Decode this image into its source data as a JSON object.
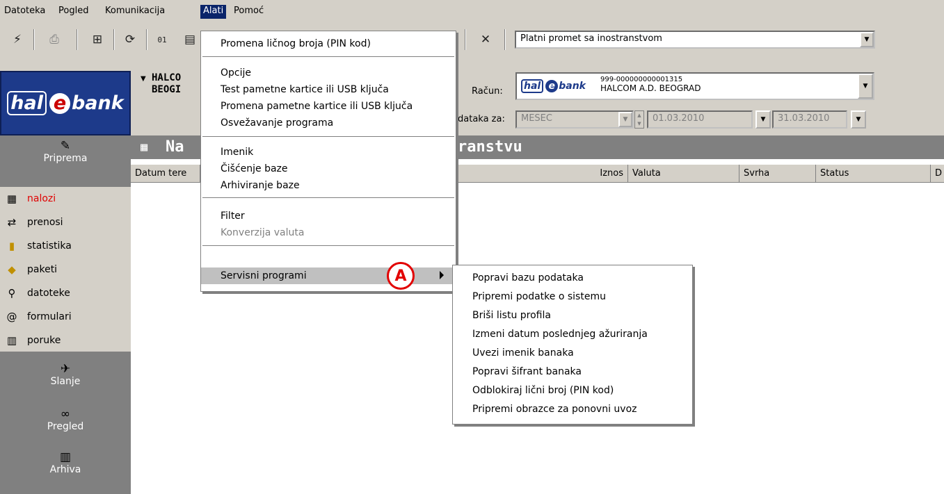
{
  "menubar": [
    "Datoteka",
    "Pogled",
    "Komunikacija",
    "Alati",
    "Pomoć"
  ],
  "toolbar": {
    "icons": [
      "signal-icon",
      "print-icon",
      "book-icon",
      "sync-icon",
      "binary-icon",
      "doc-icon",
      "tools-icon"
    ],
    "payment_type": "Platni promet sa inostranstvom"
  },
  "header": {
    "company_line1": "HALCO",
    "company_line2": "BEOGI",
    "account_label": "Račun:",
    "account_number": "999-000000000001315",
    "account_owner": "HALCOM A.D. BEOGRAD",
    "period_label": "dataka za:",
    "period_value": "MESEC",
    "date_from": "01.03.2010",
    "date_to": "31.03.2010"
  },
  "title": {
    "left": "Na",
    "right": "ranstvu"
  },
  "columns": [
    "Datum tere",
    "Iznos",
    "Valuta",
    "Svrha",
    "Status",
    "D"
  ],
  "sidebar": {
    "logo": "hal e bank",
    "logo_parts": [
      "hal",
      "e",
      "bank"
    ],
    "sections": [
      "Priprema",
      "Slanje",
      "Pregled",
      "Arhiva"
    ],
    "items": [
      {
        "label": "nalozi",
        "icon": "orders-icon"
      },
      {
        "label": "prenosi",
        "icon": "transfer-icon"
      },
      {
        "label": "statistika",
        "icon": "chart-icon"
      },
      {
        "label": "paketi",
        "icon": "package-icon"
      },
      {
        "label": "datoteke",
        "icon": "file-icon"
      },
      {
        "label": "formulari",
        "icon": "form-icon"
      },
      {
        "label": "poruke",
        "icon": "message-icon"
      }
    ]
  },
  "alati_menu": [
    "Promena ličnog broja (PIN kod)",
    "Opcije",
    "Test pametne kartice ili USB ključa",
    "Promena pametne kartice ili USB ključa",
    "Osvežavanje programa",
    "Imenik",
    "Čišćenje baze",
    "Arhiviranje baze",
    "Filter",
    "Konverzija valuta",
    "Servisni programi"
  ],
  "annotation": "A",
  "servisni_menu": [
    "Popravi bazu podataka",
    "Pripremi podatke o sistemu",
    "Briši listu profila",
    "Izmeni datum poslednjeg ažuriranja",
    "Uvezi imenik banaka",
    "Popravi šifrant banaka",
    "Odblokiraj lični broj (PIN kod)",
    "Pripremi obrazce za ponovni uvoz"
  ]
}
